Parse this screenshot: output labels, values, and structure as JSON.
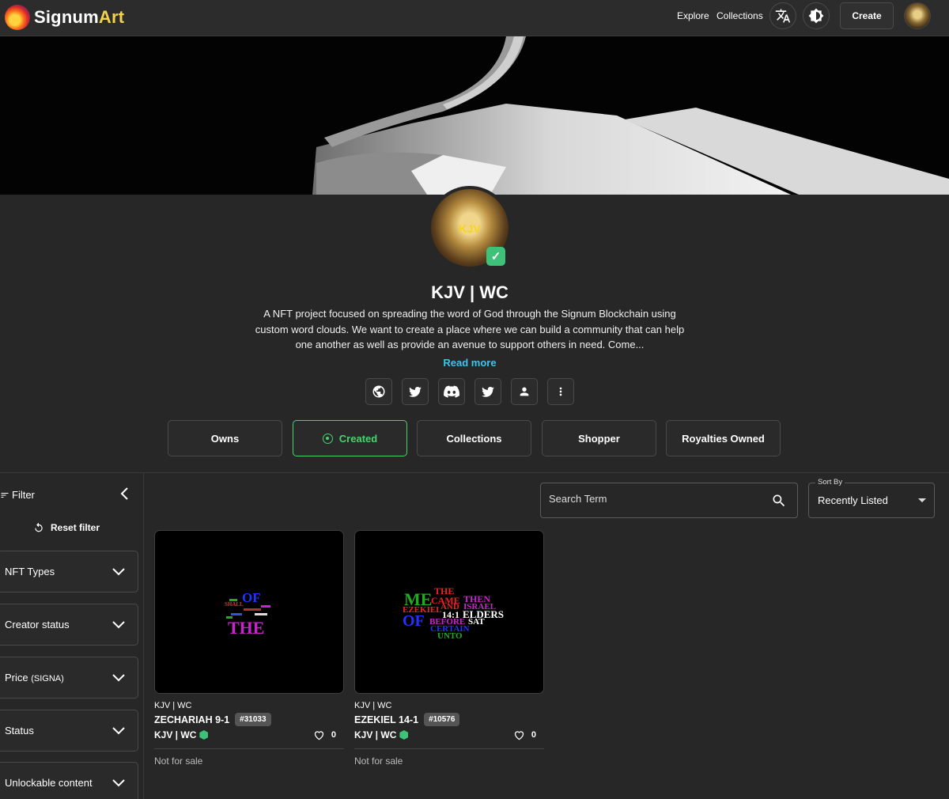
{
  "header": {
    "logo_part1": "Signum",
    "logo_part2": "Art",
    "nav": {
      "explore": "Explore",
      "collections": "Collections"
    },
    "create_label": "Create"
  },
  "profile": {
    "avatar_text": "KJV",
    "name": "KJV | WC",
    "description": "A NFT project focused on spreading the word of God through the Signum Blockchain using custom word clouds. We want to create a place where we can build a community that can help one another as well as provide an avenue to support others in need. Come...",
    "read_more": "Read more"
  },
  "social_icons": [
    "globe-icon",
    "twitter-icon",
    "discord-icon",
    "twitter-icon",
    "user-icon",
    "more-vert-icon"
  ],
  "tabs": [
    {
      "label": "Owns",
      "active": false
    },
    {
      "label": "Created",
      "active": true
    },
    {
      "label": "Collections",
      "active": false
    },
    {
      "label": "Shopper",
      "active": false
    },
    {
      "label": "Royalties Owned",
      "active": false
    }
  ],
  "sidebar": {
    "filter_label": "Filter",
    "reset_label": "Reset filter",
    "sections": [
      {
        "label": "NFT Types"
      },
      {
        "label": "Creator status"
      },
      {
        "label": "Price",
        "suffix": "(SIGNA)"
      },
      {
        "label": "Status"
      },
      {
        "label": "Unlockable content"
      }
    ]
  },
  "search": {
    "placeholder": "Search Term"
  },
  "sort": {
    "label": "Sort By",
    "value": "Recently Listed"
  },
  "cards": [
    {
      "collection": "KJV | WC",
      "title": "ZECHARIAH 9-1",
      "id": "#31033",
      "creator": "KJV | WC",
      "likes": "0",
      "status": "Not for sale",
      "words": [
        "OF",
        "THE",
        "SHALL"
      ]
    },
    {
      "collection": "KJV | WC",
      "title": "EZEKIEL 14-1",
      "id": "#10576",
      "creator": "KJV | WC",
      "likes": "0",
      "status": "Not for sale",
      "words": [
        "THE",
        "ME",
        "CAME",
        "THEN",
        "EZEKIEL",
        "AND",
        "ISRAEL",
        "14:1",
        "ELDERS",
        "OF",
        "BEFORE",
        "SAT",
        "CERTAIN",
        "UNTO"
      ]
    }
  ],
  "colors": {
    "accent_green": "#49d36b",
    "link_blue": "#3fc4ec",
    "logo_yellow": "#f3d34a",
    "badge_green": "#3ec27a"
  }
}
